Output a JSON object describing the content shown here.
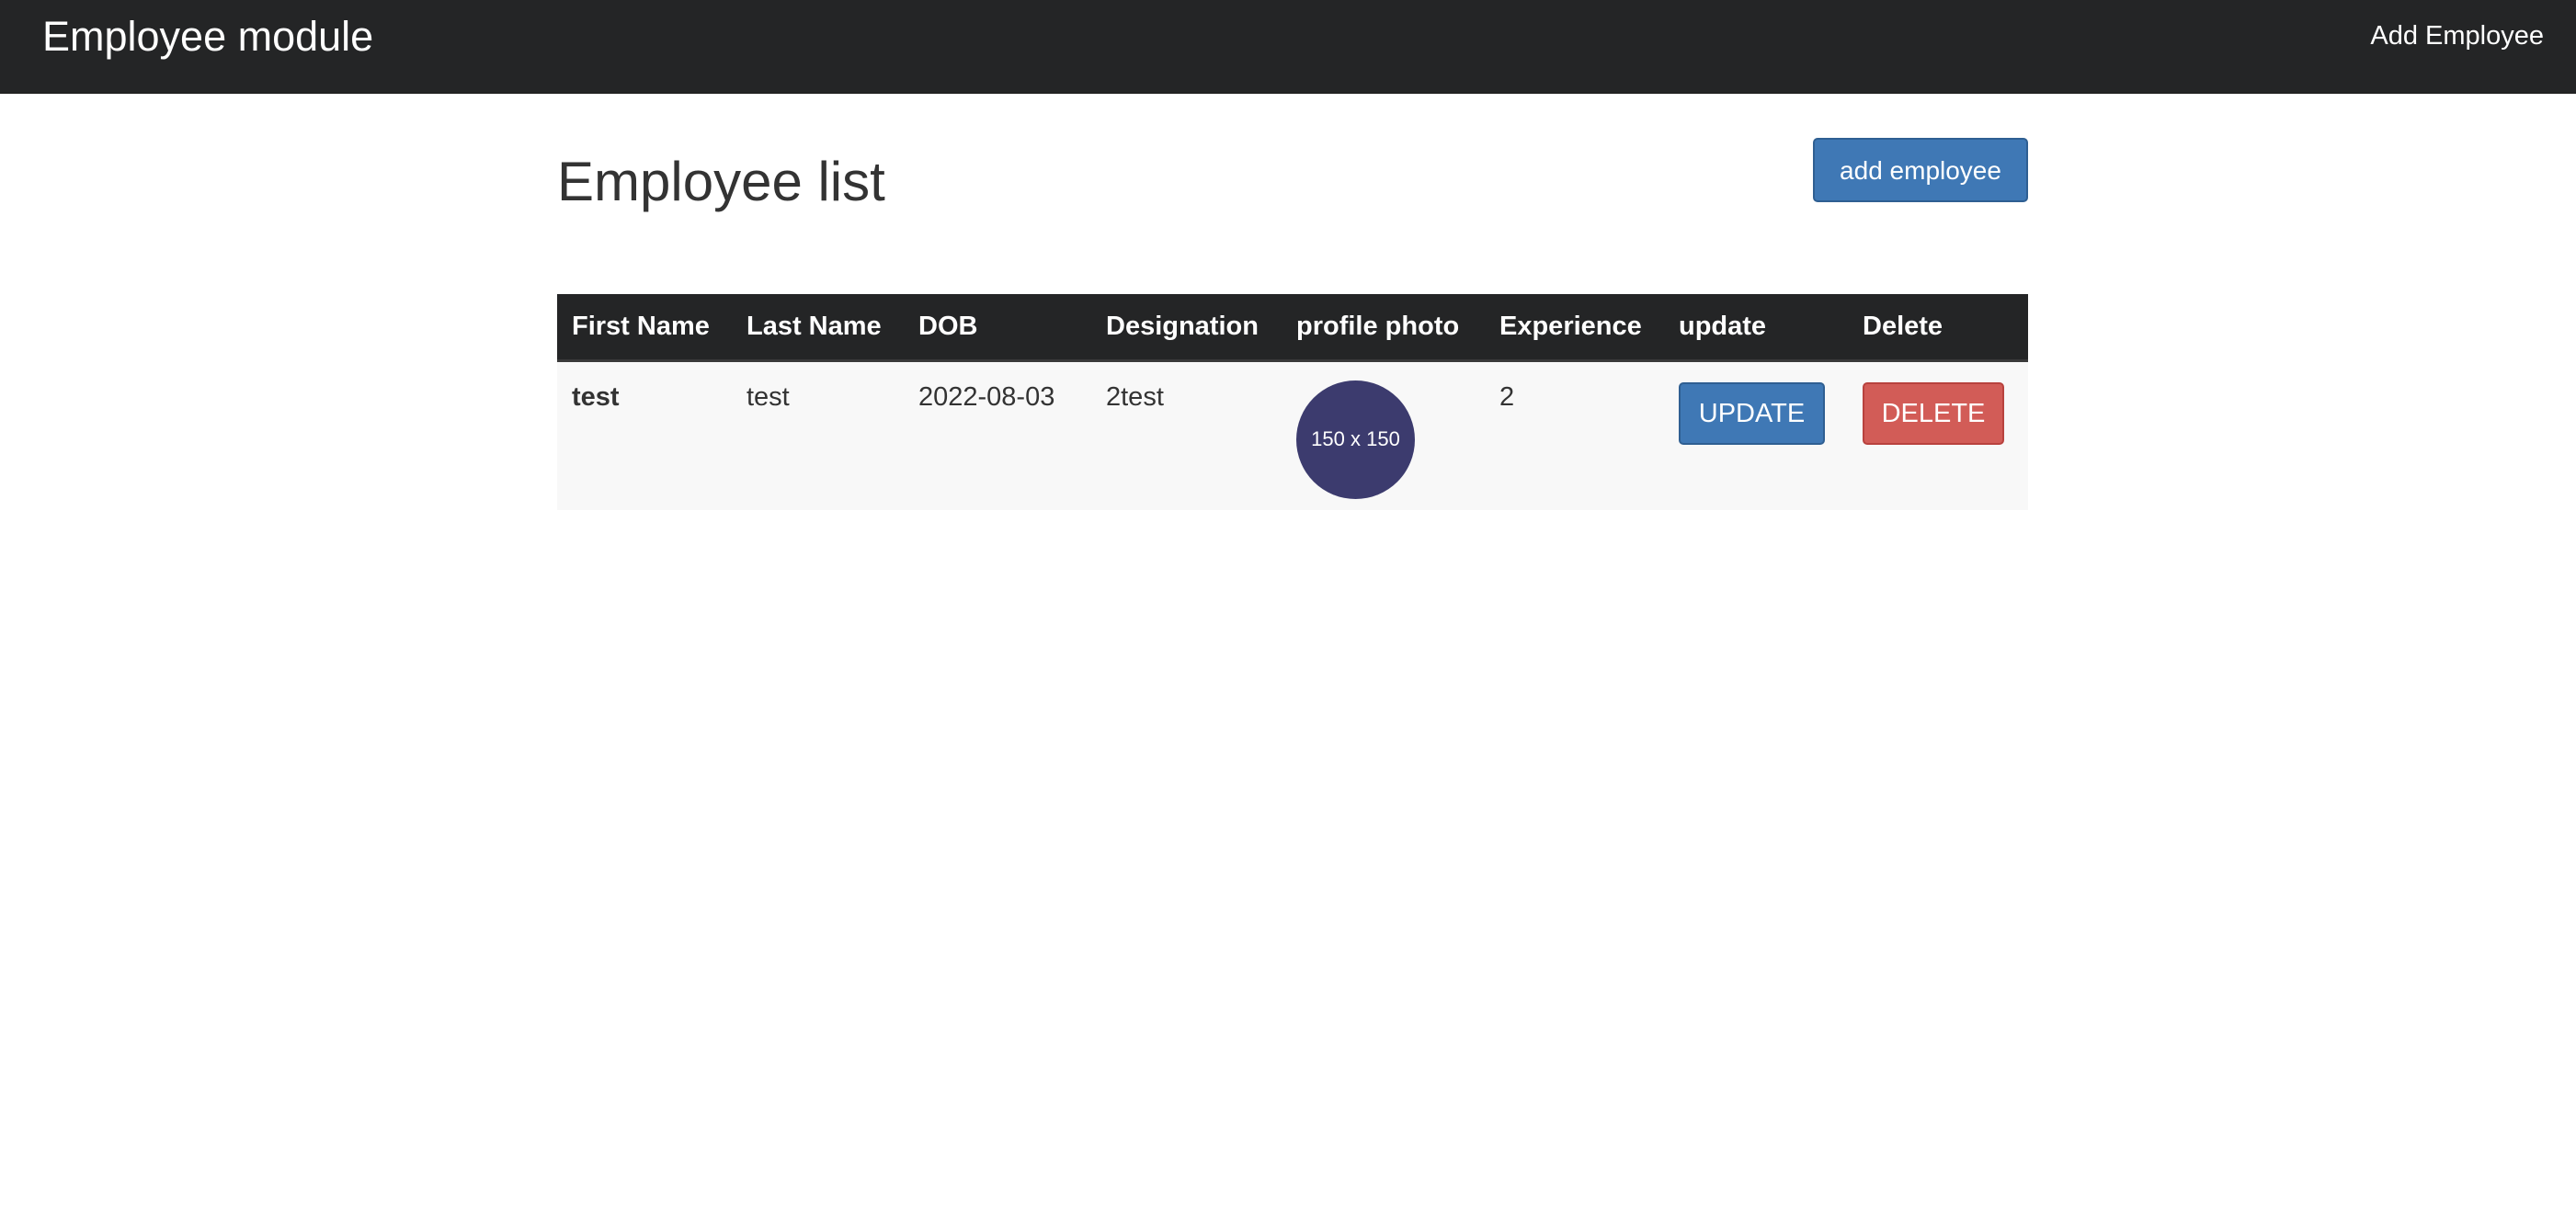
{
  "navbar": {
    "brand": "Employee module",
    "add_link": "Add Employee"
  },
  "page": {
    "title": "Employee list",
    "add_button": "add employee"
  },
  "table": {
    "headers": [
      "First Name",
      "Last Name",
      "DOB",
      "Designation",
      "profile photo",
      "Experience",
      "update",
      "Delete"
    ],
    "rows": [
      {
        "first_name": "test",
        "last_name": "test",
        "dob": "2022-08-03",
        "designation": "2test",
        "photo_placeholder": "150 x 150",
        "experience": "2",
        "update_label": "UPDATE",
        "delete_label": "DELETE"
      }
    ]
  },
  "colors": {
    "navbar_bg": "#242526",
    "primary": "#3f78b5",
    "danger": "#d25c57",
    "avatar_bg": "#3c3b6e"
  }
}
